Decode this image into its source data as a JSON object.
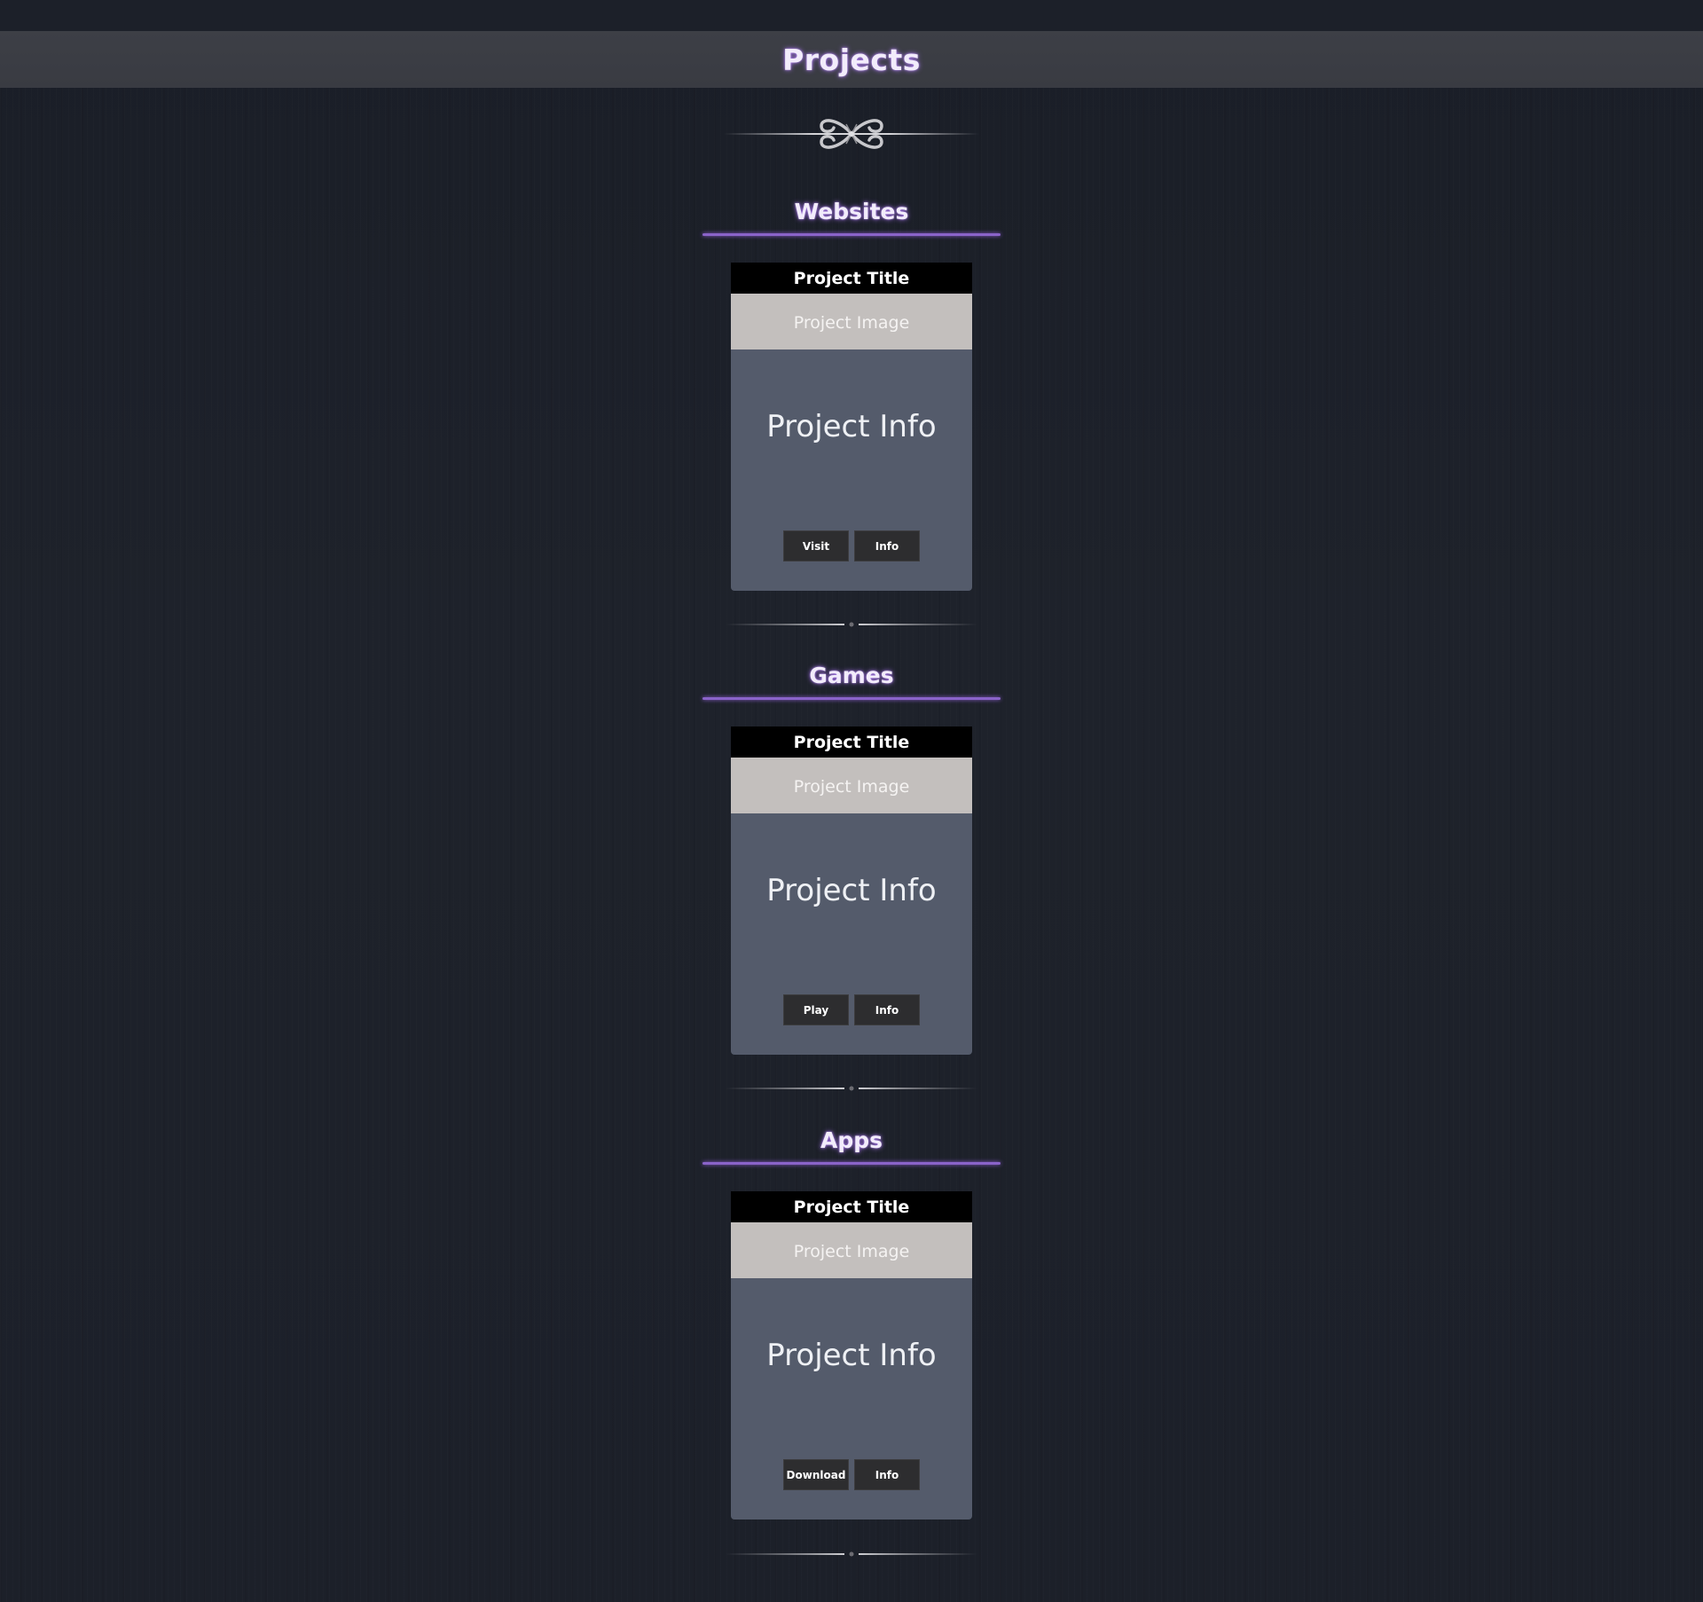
{
  "header": {
    "title": "Projects"
  },
  "sections": [
    {
      "heading": "Websites",
      "card": {
        "title": "Project Title",
        "image_placeholder": "Project Image",
        "info": "Project Info",
        "buttons": [
          "Visit",
          "Info"
        ]
      }
    },
    {
      "heading": "Games",
      "card": {
        "title": "Project Title",
        "image_placeholder": "Project Image",
        "info": "Project Info",
        "buttons": [
          "Play",
          "Info"
        ]
      }
    },
    {
      "heading": "Apps",
      "card": {
        "title": "Project Title",
        "image_placeholder": "Project Image",
        "info": "Project Info",
        "buttons": [
          "Download",
          "Info"
        ]
      }
    }
  ],
  "colors": {
    "page_background": "#1d212a",
    "header_bar": "#3c3e45",
    "title_glow": "#b278ff",
    "section_underline": "#8a63c9",
    "card_title_bg": "#000000",
    "card_image_bg": "#c3bfbd",
    "card_body_bg": "#545b6b",
    "button_bg": "#2d2d2f"
  },
  "icons": {
    "ornament": "scroll-ornament-icon",
    "divider": "line-divider-icon"
  }
}
